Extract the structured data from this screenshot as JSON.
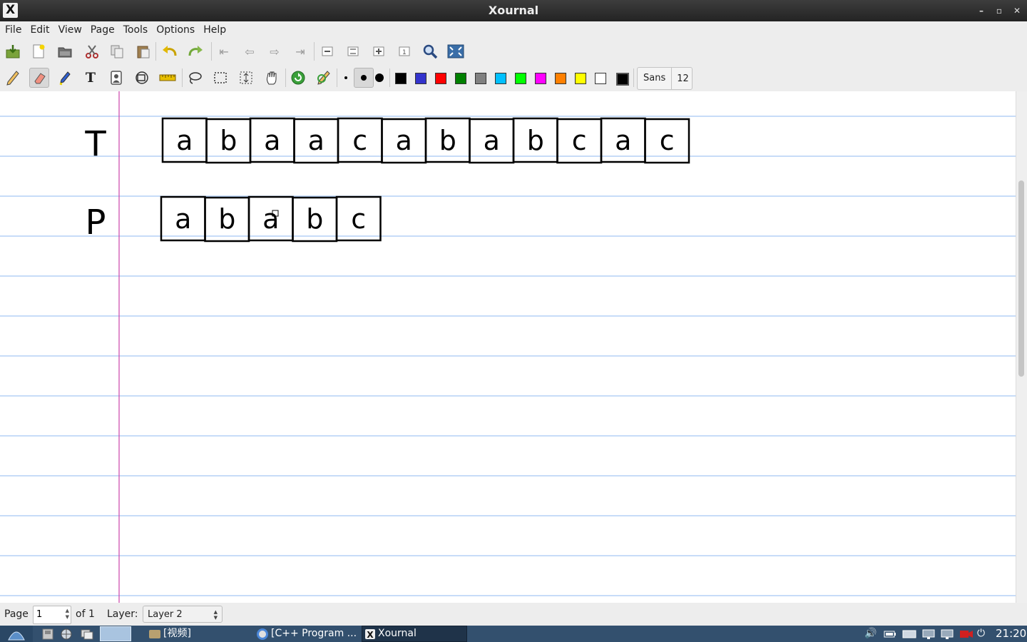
{
  "window": {
    "title": "Xournal",
    "app_icon": "xournal-x-icon",
    "controls": [
      "minimize-icon",
      "maximize-icon",
      "close-icon"
    ]
  },
  "menu": [
    "File",
    "Edit",
    "View",
    "Page",
    "Tools",
    "Options",
    "Help"
  ],
  "toolbar1": [
    {
      "name": "save-button",
      "icon": "save-icon"
    },
    {
      "name": "new-button",
      "icon": "new-document-icon"
    },
    {
      "name": "open-button",
      "icon": "open-folder-icon"
    },
    {
      "name": "cut-button",
      "icon": "scissors-icon"
    },
    {
      "name": "copy-button",
      "icon": "copy-icon"
    },
    {
      "name": "paste-button",
      "icon": "paste-icon"
    },
    {
      "name": "undo-button",
      "icon": "undo-icon"
    },
    {
      "name": "redo-button",
      "icon": "redo-icon"
    },
    {
      "name": "first-page-button",
      "icon": "first-page-icon"
    },
    {
      "name": "prev-page-button",
      "icon": "arrow-left-icon"
    },
    {
      "name": "next-page-button",
      "icon": "arrow-right-icon"
    },
    {
      "name": "last-page-button",
      "icon": "last-page-icon"
    },
    {
      "name": "zoom-out-button",
      "icon": "zoom-out-icon"
    },
    {
      "name": "zoom-fit-button",
      "icon": "zoom-fit-icon"
    },
    {
      "name": "zoom-in-button",
      "icon": "zoom-in-icon"
    },
    {
      "name": "zoom-100-button",
      "icon": "zoom-normal-icon"
    },
    {
      "name": "zoom-set-button",
      "icon": "magnifier-icon"
    },
    {
      "name": "fullscreen-button",
      "icon": "fullscreen-icon"
    }
  ],
  "toolbar2": {
    "tools": [
      {
        "name": "pen-tool",
        "icon": "pen-icon"
      },
      {
        "name": "eraser-tool",
        "icon": "eraser-icon",
        "active": true
      },
      {
        "name": "highlighter-tool",
        "icon": "highlighter-icon"
      },
      {
        "name": "text-tool",
        "icon": "text-tool-icon",
        "glyph": "T"
      },
      {
        "name": "image-tool",
        "icon": "image-icon"
      },
      {
        "name": "shape-recognizer-tool",
        "icon": "shape-recognizer-icon"
      },
      {
        "name": "ruler-tool",
        "icon": "ruler-icon"
      },
      {
        "name": "select-region-tool",
        "icon": "lasso-icon"
      },
      {
        "name": "select-rectangle-tool",
        "icon": "select-rectangle-icon"
      },
      {
        "name": "vertical-space-tool",
        "icon": "vertical-space-icon"
      },
      {
        "name": "hand-tool",
        "icon": "hand-icon"
      },
      {
        "name": "default-tool",
        "icon": "default-tool-icon"
      },
      {
        "name": "default-pen",
        "icon": "default-pen-icon"
      }
    ],
    "thickness": [
      "thin-dot-icon",
      "medium-dot-icon",
      "thick-dot-icon"
    ],
    "colors": [
      "#000000",
      "#3333cc",
      "#ff0000",
      "#008000",
      "#808080",
      "#00c0ff",
      "#00ff00",
      "#ff00ff",
      "#ff8000",
      "#ffff00",
      "#ffffff"
    ],
    "current_color": "#000000",
    "font_name": "Sans",
    "font_size": "12"
  },
  "page_content": {
    "rule_color": "#8fb8f0",
    "margin_color": "#cc44aa",
    "rows": [
      {
        "label": "T",
        "cells": [
          "a",
          "b",
          "a",
          "a",
          "c",
          "a",
          "b",
          "a",
          "b",
          "c",
          "a",
          "c"
        ]
      },
      {
        "label": "P",
        "cells": [
          "a",
          "b",
          "a",
          "b",
          "c"
        ]
      }
    ]
  },
  "status": {
    "page_label": "Page",
    "page_value": "1",
    "of_label": "of 1",
    "layer_label": "Layer:",
    "layer_value": "Layer 2"
  },
  "taskbar": {
    "tasks": [
      {
        "label": "[视频]",
        "icon": "folder-icon"
      },
      {
        "label": "[C++ Program ...",
        "icon": "chrome-icon"
      },
      {
        "label": "Xournal",
        "icon": "xournal-x-icon",
        "active": true
      }
    ],
    "clock": "21:20"
  }
}
